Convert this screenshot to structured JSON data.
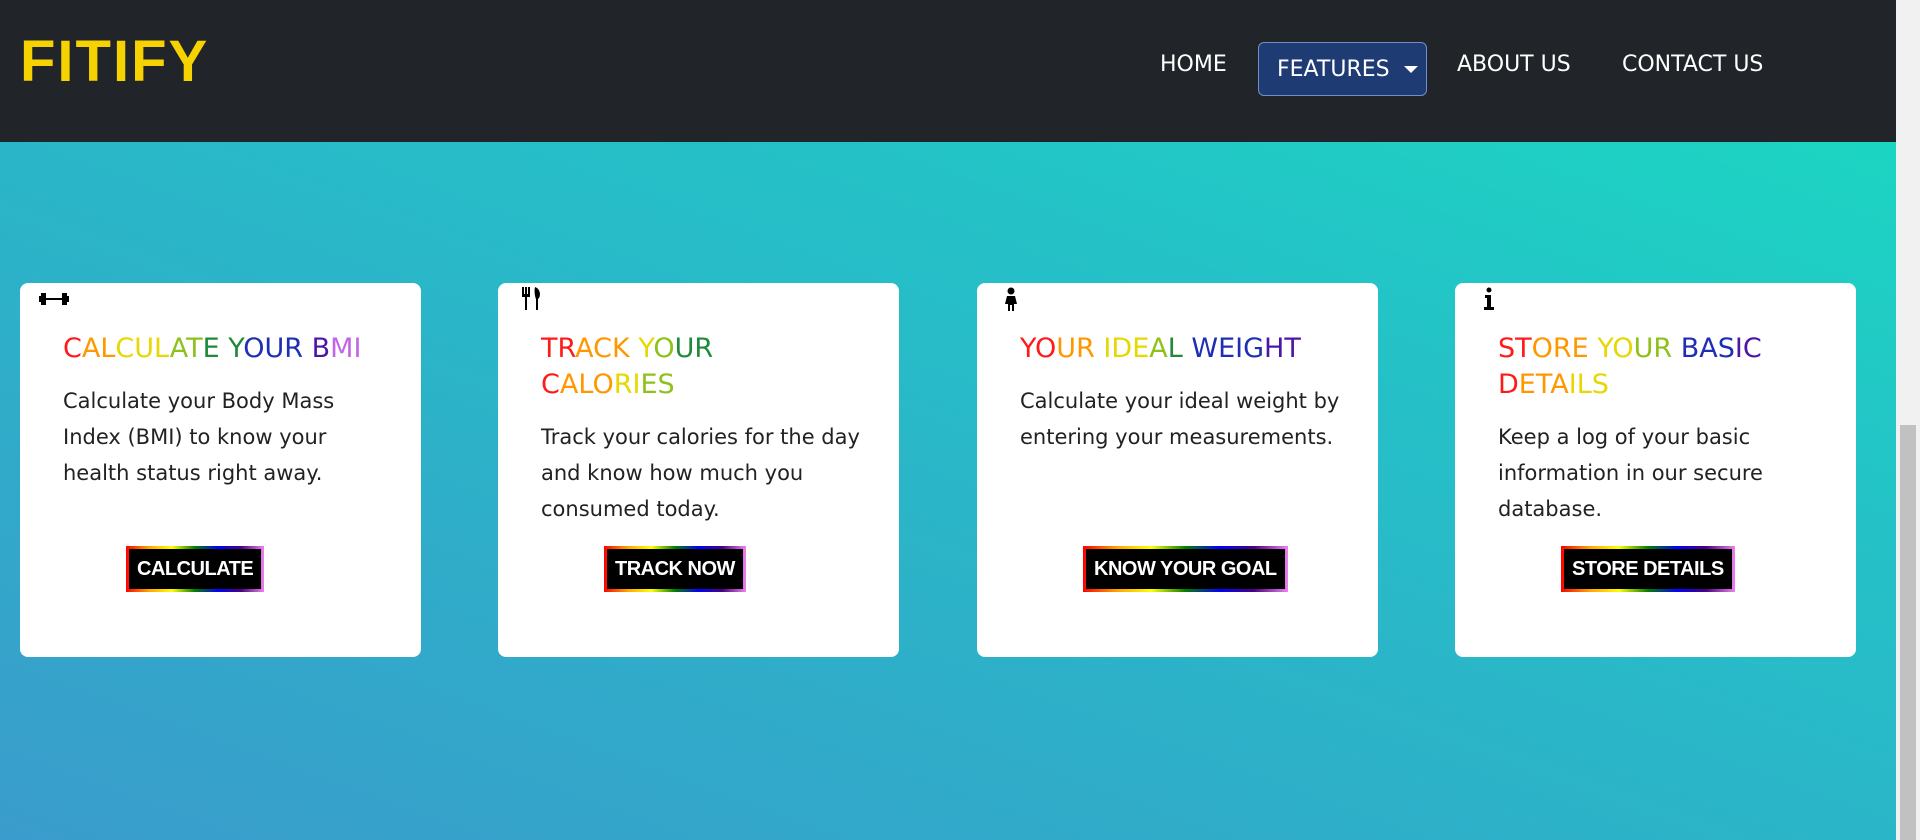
{
  "navbar": {
    "brand": "FITIFY",
    "items": [
      {
        "label": "HOME"
      },
      {
        "label": "FEATURES"
      },
      {
        "label": "ABOUT US"
      },
      {
        "label": "CONTACT US"
      }
    ]
  },
  "cards": [
    {
      "icon": "dumbbell-icon",
      "title_parts": [
        "CAL",
        "CULATE ",
        "YOUR ",
        "BMI"
      ],
      "title": "CALCULATE YOUR BMI",
      "text": "Calculate your Body Mass Index (BMI) to know your health status right away.",
      "button": "CALCULATE"
    },
    {
      "icon": "utensils-icon",
      "title": "TRACK YOUR CALORIES",
      "text": "Track your calories for the day and know how much you consumed today.",
      "button": "TRACK NOW"
    },
    {
      "icon": "person-icon",
      "title": "YOUR IDEAL WEIGHT",
      "text": "Calculate your ideal weight by entering your measurements.",
      "button": "KNOW YOUR GOAL"
    },
    {
      "icon": "info-icon",
      "title": "STORE YOUR BASIC DETAILS",
      "text": "Keep a log of your basic information in our secure database.",
      "button": "STORE DETAILS"
    }
  ],
  "colors": {
    "navbar_bg": "#212529",
    "brand": "#f5d200",
    "features_bg": "#1f3b73",
    "card_bg": "#ffffff",
    "button_bg": "#000000"
  }
}
